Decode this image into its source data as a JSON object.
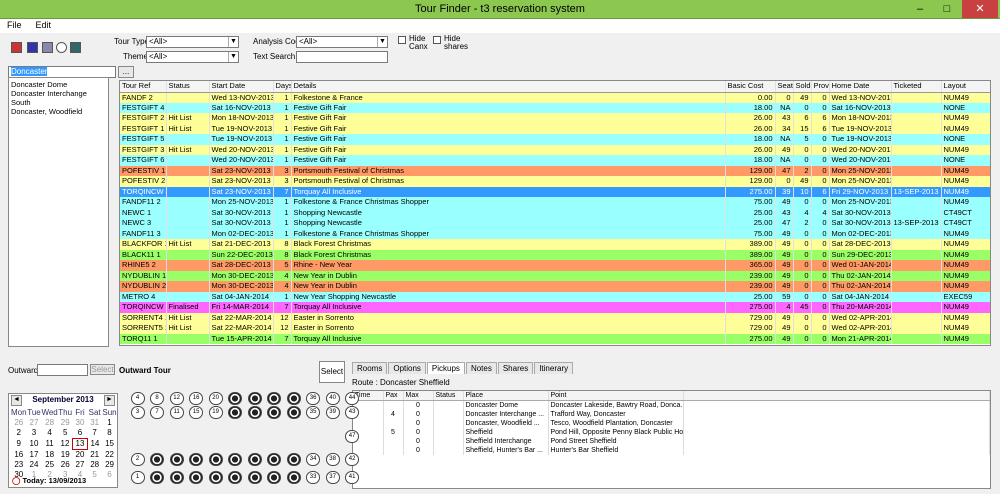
{
  "window": {
    "title": "Tour Finder - t3 reservation system",
    "min": "–",
    "max": "□",
    "close": "✕"
  },
  "menu": [
    "File",
    "Edit"
  ],
  "filters": {
    "tour_type_label": "Tour Type",
    "tour_type_value": "<All>",
    "theme_label": "Theme",
    "theme_value": "<All>",
    "analysis_label": "Analysis Code",
    "analysis_value": "<All>",
    "text_search_label": "Text Search",
    "text_search_value": "",
    "hide_canx": "Hide\nCanx",
    "hide_shares": "Hide\nshares"
  },
  "search": {
    "value": "Doncaster",
    "browse": "..."
  },
  "places": [
    "Doncaster Dome",
    "Doncaster Interchange South",
    "Doncaster, Woodfield"
  ],
  "columns": [
    "Tour Ref",
    "Status",
    "Start Date",
    "Days",
    "Details",
    "Basic Cost",
    "Seats",
    "Sold",
    "Prov",
    "Home Date",
    "Ticketed",
    "Layout"
  ],
  "rows": [
    {
      "ref": "FANDF    2",
      "status": "",
      "start": "Wed 13-NOV-2013",
      "days": "1",
      "details": "Folkestone & France",
      "cost": "0.00",
      "seats": "0",
      "sold": "49",
      "prov": "0",
      "home": "Wed 13-NOV-2013",
      "ticketed": "",
      "layout": "NUM49",
      "color": "#ffff99"
    },
    {
      "ref": "FESTGIFT 4",
      "status": "",
      "start": "Sat 16-NOV-2013",
      "days": "1",
      "details": "Festive Gift Fair",
      "cost": "18.00",
      "seats": "NA",
      "sold": "0",
      "prov": "0",
      "home": "Sat 16-NOV-2013",
      "ticketed": "",
      "layout": "NONE",
      "color": "#99ffff"
    },
    {
      "ref": "FESTGIFT 2",
      "status": "Hit List",
      "start": "Mon 18-NOV-2013",
      "days": "1",
      "details": "Festive Gift Fair",
      "cost": "26.00",
      "seats": "43",
      "sold": "6",
      "prov": "6",
      "home": "Mon 18-NOV-2013",
      "ticketed": "",
      "layout": "NUM49",
      "color": "#ffff99"
    },
    {
      "ref": "FESTGIFT 1",
      "status": "Hit List",
      "start": "Tue 19-NOV-2013",
      "days": "1",
      "details": "Festive Gift Fair",
      "cost": "26.00",
      "seats": "34",
      "sold": "15",
      "prov": "6",
      "home": "Tue 19-NOV-2013",
      "ticketed": "",
      "layout": "NUM49",
      "color": "#ffff99"
    },
    {
      "ref": "FESTGIFT 5",
      "status": "",
      "start": "Tue 19-NOV-2013",
      "days": "1",
      "details": "Festive Gift Fair",
      "cost": "18.00",
      "seats": "NA",
      "sold": "5",
      "prov": "0",
      "home": "Tue 19-NOV-2013",
      "ticketed": "",
      "layout": "NONE",
      "color": "#99ffff"
    },
    {
      "ref": "FESTGIFT 3",
      "status": "Hit List",
      "start": "Wed 20-NOV-2013",
      "days": "1",
      "details": "Festive Gift Fair",
      "cost": "26.00",
      "seats": "49",
      "sold": "0",
      "prov": "0",
      "home": "Wed 20-NOV-2013",
      "ticketed": "",
      "layout": "NUM49",
      "color": "#ffff99"
    },
    {
      "ref": "FESTGIFT 6",
      "status": "",
      "start": "Wed 20-NOV-2013",
      "days": "1",
      "details": "Festive Gift Fair",
      "cost": "18.00",
      "seats": "NA",
      "sold": "0",
      "prov": "0",
      "home": "Wed 20-NOV-2013",
      "ticketed": "",
      "layout": "NONE",
      "color": "#99ffff"
    },
    {
      "ref": "POFESTIV 1",
      "status": "",
      "start": "Sat 23-NOV-2013",
      "days": "3",
      "details": "Portsmouth Festival of Christmas",
      "cost": "129.00",
      "seats": "47",
      "sold": "2",
      "prov": "0",
      "home": "Mon 25-NOV-2013",
      "ticketed": "",
      "layout": "NUM49",
      "color": "#ff9966"
    },
    {
      "ref": "POFESTIV 2",
      "status": "",
      "start": "Sat 23-NOV-2013",
      "days": "3",
      "details": "Portsmouth Festival of Christmas",
      "cost": "129.00",
      "seats": "0",
      "sold": "49",
      "prov": "0",
      "home": "Mon 25-NOV-2013",
      "ticketed": "",
      "layout": "NUM49",
      "color": "#ffff99"
    },
    {
      "ref": "TORQINCW 4",
      "status": "",
      "start": "Sat 23-NOV-2013",
      "days": "7",
      "details": "Torquay All Inclusive",
      "cost": "275.00",
      "seats": "39",
      "sold": "10",
      "prov": "6",
      "home": "Fri 29-NOV-2013",
      "ticketed": "13-SEP-2013",
      "layout": "NUM49",
      "color": "#3399ff",
      "selected": true
    },
    {
      "ref": "FANDF11  2",
      "status": "",
      "start": "Mon 25-NOV-2013",
      "days": "1",
      "details": "Folkestone & France Christmas Shopper",
      "cost": "75.00",
      "seats": "49",
      "sold": "0",
      "prov": "0",
      "home": "Mon 25-NOV-2013",
      "ticketed": "",
      "layout": "NUM49",
      "color": "#99ffff"
    },
    {
      "ref": "NEWC     1",
      "status": "",
      "start": "Sat 30-NOV-2013",
      "days": "1",
      "details": "Shopping Newcastle",
      "cost": "25.00",
      "seats": "43",
      "sold": "4",
      "prov": "4",
      "home": "Sat 30-NOV-2013",
      "ticketed": "",
      "layout": "CT49CT",
      "color": "#99ffff"
    },
    {
      "ref": "NEWC     3",
      "status": "",
      "start": "Sat 30-NOV-2013",
      "days": "1",
      "details": "Shopping Newcastle",
      "cost": "25.00",
      "seats": "47",
      "sold": "2",
      "prov": "0",
      "home": "Sat 30-NOV-2013",
      "ticketed": "13-SEP-2013",
      "layout": "CT49CT",
      "color": "#99ffff"
    },
    {
      "ref": "FANDF11  3",
      "status": "",
      "start": "Mon 02-DEC-2013",
      "days": "1",
      "details": "Folkestone & France Christmas Shopper",
      "cost": "75.00",
      "seats": "49",
      "sold": "0",
      "prov": "0",
      "home": "Mon 02-DEC-2013",
      "ticketed": "",
      "layout": "NUM49",
      "color": "#99ffff"
    },
    {
      "ref": "BLACKFOR 1",
      "status": "Hit List",
      "start": "Sat 21-DEC-2013",
      "days": "8",
      "details": "Black Forest Christmas",
      "cost": "389.00",
      "seats": "49",
      "sold": "0",
      "prov": "0",
      "home": "Sat 28-DEC-2013",
      "ticketed": "",
      "layout": "NUM49",
      "color": "#ffff99"
    },
    {
      "ref": "BLACK11  1",
      "status": "",
      "start": "Sun 22-DEC-2013",
      "days": "8",
      "details": "Black Forest Christmas",
      "cost": "389.00",
      "seats": "49",
      "sold": "0",
      "prov": "0",
      "home": "Sun 29-DEC-2013",
      "ticketed": "",
      "layout": "NUM49",
      "color": "#99ff66"
    },
    {
      "ref": "RHINE5   2",
      "status": "",
      "start": "Sat 28-DEC-2013",
      "days": "5",
      "details": "Rhine - New Year",
      "cost": "365.00",
      "seats": "49",
      "sold": "0",
      "prov": "0",
      "home": "Wed 01-JAN-2014",
      "ticketed": "",
      "layout": "NUM49",
      "color": "#ff9966"
    },
    {
      "ref": "NYDUBLIN 1",
      "status": "",
      "start": "Mon 30-DEC-2013",
      "days": "4",
      "details": "New Year in Dublin",
      "cost": "239.00",
      "seats": "49",
      "sold": "0",
      "prov": "0",
      "home": "Thu 02-JAN-2014",
      "ticketed": "",
      "layout": "NUM49",
      "color": "#99ff66"
    },
    {
      "ref": "NYDUBLIN 2",
      "status": "",
      "start": "Mon 30-DEC-2013",
      "days": "4",
      "details": "New Year in Dublin",
      "cost": "239.00",
      "seats": "49",
      "sold": "0",
      "prov": "0",
      "home": "Thu 02-JAN-2014",
      "ticketed": "",
      "layout": "NUM49",
      "color": "#ff9966"
    },
    {
      "ref": "METRO    4",
      "status": "",
      "start": "Sat 04-JAN-2014",
      "days": "1",
      "details": "New Year Shopping Newcastle",
      "cost": "25.00",
      "seats": "59",
      "sold": "0",
      "prov": "0",
      "home": "Sat 04-JAN-2014",
      "ticketed": "",
      "layout": "EXEC59",
      "color": "#99ffff"
    },
    {
      "ref": "TORQINCW 3",
      "status": "Finalised",
      "start": "Fri 14-MAR-2014",
      "days": "7",
      "details": "Torquay All Inclusive",
      "cost": "275.00",
      "seats": "4",
      "sold": "45",
      "prov": "0",
      "home": "Thu 20-MAR-2014",
      "ticketed": "",
      "layout": "NUM49",
      "color": "#ff66ff"
    },
    {
      "ref": "SORRENT4 1",
      "status": "Hit List",
      "start": "Sat 22-MAR-2014",
      "days": "12",
      "details": "Easter in Sorrento",
      "cost": "729.00",
      "seats": "49",
      "sold": "0",
      "prov": "0",
      "home": "Wed 02-APR-2014",
      "ticketed": "",
      "layout": "NUM49",
      "color": "#ffff99"
    },
    {
      "ref": "SORRENT5 1",
      "status": "Hit List",
      "start": "Sat 22-MAR-2014",
      "days": "12",
      "details": "Easter in Sorrento",
      "cost": "729.00",
      "seats": "49",
      "sold": "0",
      "prov": "0",
      "home": "Wed 02-APR-2014",
      "ticketed": "",
      "layout": "NUM49",
      "color": "#ffff99"
    },
    {
      "ref": "TORQ11   1",
      "status": "",
      "start": "Tue 15-APR-2014",
      "days": "7",
      "details": "Torquay All Inclusive",
      "cost": "275.00",
      "seats": "49",
      "sold": "0",
      "prov": "0",
      "home": "Mon 21-APR-2014",
      "ticketed": "",
      "layout": "NUM49",
      "color": "#99ff66"
    }
  ],
  "outward": {
    "label": "Outward",
    "value": "",
    "select": "Select",
    "tour_label": "Outward Tour",
    "select_big": "Select"
  },
  "tabs": [
    "Rooms",
    "Options",
    "Pickups",
    "Notes",
    "Shares",
    "Itinerary"
  ],
  "active_tab": "Pickups",
  "route": "Route : Doncaster Sheffield",
  "pick_columns": [
    "Time",
    "Pax",
    "Max",
    "Status",
    "Place",
    "Point"
  ],
  "pickups": [
    {
      "time": "",
      "pax": "",
      "max": "0",
      "status": "",
      "place": "Doncaster Dome",
      "point": "Doncaster Lakeside, Bawtry Road, Donca..."
    },
    {
      "time": "",
      "pax": "4",
      "max": "0",
      "status": "",
      "place": "Doncaster Interchange ...",
      "point": "Trafford Way, Doncaster"
    },
    {
      "time": "",
      "pax": "",
      "max": "0",
      "status": "",
      "place": "Doncaster, Woodfield ...",
      "point": "Tesco, Woodfield Plantation, Doncaster"
    },
    {
      "time": "",
      "pax": "5",
      "max": "0",
      "status": "",
      "place": "Sheffield",
      "point": "Pond Hill, Opposite Penny Black Public Ho..."
    },
    {
      "time": "",
      "pax": "",
      "max": "0",
      "status": "",
      "place": "Sheffield Interchange",
      "point": "Pond Street Sheffield"
    },
    {
      "time": "",
      "pax": "",
      "max": "0",
      "status": "",
      "place": "Sheffield, Hunter's Bar ...",
      "point": "Hunter's Bar Sheffield"
    }
  ],
  "calendar": {
    "month": "September 2013",
    "days": [
      "Mon",
      "Tue",
      "Wed",
      "Thu",
      "Fri",
      "Sat",
      "Sun"
    ],
    "weeks": [
      [
        "26",
        "27",
        "28",
        "29",
        "30",
        "31",
        "1"
      ],
      [
        "2",
        "3",
        "4",
        "5",
        "6",
        "7",
        "8"
      ],
      [
        "9",
        "10",
        "11",
        "12",
        "13",
        "14",
        "15"
      ],
      [
        "16",
        "17",
        "18",
        "19",
        "20",
        "21",
        "22"
      ],
      [
        "23",
        "24",
        "25",
        "26",
        "27",
        "28",
        "29"
      ],
      [
        "30",
        "1",
        "2",
        "3",
        "4",
        "5",
        "6"
      ]
    ],
    "today": "Today: 13/09/2013",
    "prev": "◄",
    "next": "►"
  },
  "seats": [
    "4",
    "8",
    "12",
    "16",
    "20",
    "",
    "",
    "",
    "",
    "36",
    "40",
    "44",
    "3",
    "7",
    "11",
    "15",
    "19",
    "",
    "",
    "",
    "",
    "35",
    "39",
    "43",
    "",
    "",
    "",
    "",
    "",
    "",
    "",
    "",
    "",
    "",
    "",
    "47",
    "2",
    "",
    "",
    "",
    "",
    "",
    "",
    "",
    "",
    "34",
    "38",
    "42",
    "1",
    "",
    "",
    "",
    "",
    "",
    "",
    "",
    "",
    "33",
    "37",
    "41"
  ]
}
